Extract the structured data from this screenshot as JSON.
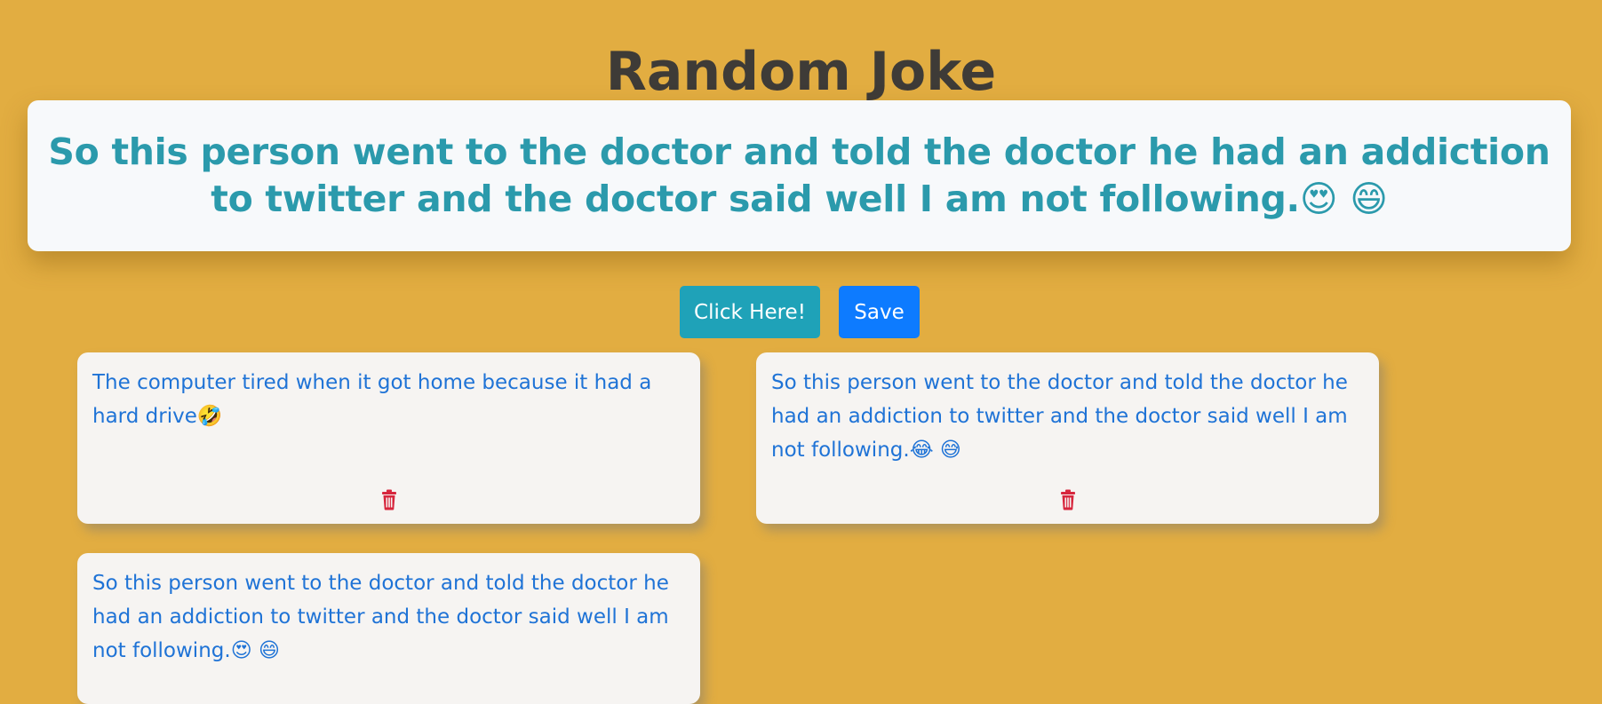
{
  "title": "Random Joke",
  "hero": {
    "joke": "So this person went to the doctor and told the doctor he had an addiction to twitter and the doctor said well I am not following.😍 😄"
  },
  "buttons": {
    "click_label": "Click Here!",
    "save_label": "Save"
  },
  "saved_jokes": [
    {
      "text": "The computer tired when it got home because it had a hard drive🤣"
    },
    {
      "text": "So this person went to the doctor and told the doctor he had an addiction to twitter and the doctor said well I am not following.😂 😅"
    },
    {
      "text": "So this person went to the doctor and told the doctor he had an addiction to twitter and the doctor said well I am not following.😍 😄"
    }
  ],
  "icons": {
    "delete": "trash-icon"
  },
  "colors": {
    "background": "#e2ad41",
    "title": "#3e3b37",
    "hero_text": "#2b9aac",
    "card_text": "#1f73d6",
    "click_button": "#1fa2b8",
    "save_button": "#0d7bff",
    "delete_icon": "#d7263d"
  }
}
